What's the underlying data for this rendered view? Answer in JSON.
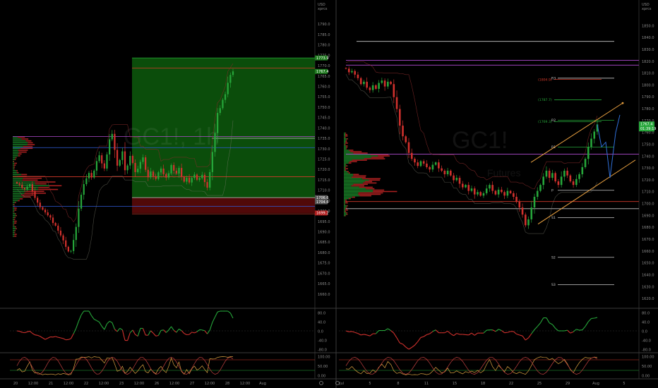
{
  "colors": {
    "background": "#000000",
    "up": "#26a63a",
    "down": "#d0312d",
    "profile_up": "#1c8f2c",
    "profile_down": "#c42626",
    "blue_line": "#2f5bd8",
    "purple_line": "#b04bd0",
    "red_line": "#d43a2a",
    "white_line": "#c8c8c8",
    "orange_channel": "#e8a040",
    "forecast": "#2f6fd8",
    "long_box": "#0d5a0d",
    "stop_box": "#5a0a0a"
  },
  "watermark": {
    "text": "GC1!, 1h",
    "subtext": "Futures"
  },
  "left_panel": {
    "currency": "USD",
    "unit": "xprcs",
    "price_ticks": [
      "1790.0",
      "1785.0",
      "1780.0",
      "1775.0",
      "1770.0",
      "1765.0",
      "1760.0",
      "1755.0",
      "1750.0",
      "1745.0",
      "1740.0",
      "1735.0",
      "1730.0",
      "1725.0",
      "1720.0",
      "1715.0",
      "1710.0",
      "1705.0",
      "1700.0",
      "1695.0",
      "1690.0",
      "1685.0",
      "1680.0",
      "1675.0",
      "1670.0",
      "1665.0",
      "1660.0"
    ],
    "time_ticks": [
      "20",
      "12:00",
      "21",
      "12:00",
      "22",
      "12:00",
      "23",
      "12:00",
      "26",
      "12:00",
      "27",
      "12:00",
      "28",
      "12:00",
      "Aug"
    ],
    "tags": [
      {
        "text": "1773.9",
        "color": "#1f7a1f"
      },
      {
        "text": "1767.4",
        "color": "#1f7a1f"
      },
      {
        "text": "1706.6",
        "color": "#555555"
      },
      {
        "text": "1704.6",
        "color": "#555555"
      },
      {
        "text": "1699.2",
        "color": "#b01c1c"
      }
    ],
    "rsi_ticks": [
      "80.0",
      "40.0",
      "0.0",
      "-40.0",
      "-80.0"
    ],
    "stoch_ticks": [
      "100.00",
      "50.00",
      "0.00"
    ]
  },
  "right_panel": {
    "currency": "USD",
    "unit": "xprcs",
    "price_ticks": [
      "1850.0",
      "1840.0",
      "1830.0",
      "1820.0",
      "1810.0",
      "1800.0",
      "1790.0",
      "1780.0",
      "1770.0",
      "1760.0",
      "1750.0",
      "1740.0",
      "1730.0",
      "1720.0",
      "1710.0",
      "1700.0",
      "1690.0",
      "1680.0",
      "1670.0",
      "1660.0",
      "1650.0",
      "1640.0",
      "1630.0",
      "1620.0"
    ],
    "time_ticks": [
      "Jul",
      "5",
      "8",
      "11",
      "15",
      "18",
      "22",
      "25",
      "29",
      "Aug",
      "5"
    ],
    "pivot_labels": [
      "R3",
      "R2",
      "R1",
      "P",
      "S1",
      "S2",
      "S3"
    ],
    "level_labels": [
      "(1804.9)",
      "(1787.7)",
      "(1769.3)"
    ],
    "tags": [
      {
        "text": "1767.4",
        "color": "#1f7a1f"
      },
      {
        "text": "01:39:19",
        "color": "#1f7a1f"
      }
    ],
    "rsi_ticks": [
      "80.0",
      "40.0",
      "0.0",
      "-40.0",
      "-80.0"
    ],
    "stoch_ticks": [
      "100.00",
      "50.00",
      "0.00"
    ]
  },
  "chart_data": [
    {
      "type": "candlestick",
      "symbol": "GC1!",
      "timeframe": "1h",
      "ylim": [
        1655,
        1795
      ],
      "x_labels": [
        "20",
        "21",
        "22",
        "23",
        "26",
        "27",
        "28",
        "Aug"
      ],
      "close": [
        1713.5,
        1712.8,
        1711.2,
        1710.6,
        1711.9,
        1713.0,
        1709.6,
        1706.5,
        1704.2,
        1702.0,
        1700.8,
        1699.5,
        1698.1,
        1697.0,
        1694.4,
        1693.1,
        1690.7,
        1688.4,
        1686.0,
        1682.9,
        1680.7,
        1680.9,
        1686.2,
        1692.5,
        1701.3,
        1708.0,
        1713.1,
        1715.9,
        1718.5,
        1716.3,
        1719.6,
        1724.2,
        1727.0,
        1723.1,
        1720.6,
        1727.4,
        1734.7,
        1737.3,
        1729.6,
        1722.0,
        1724.7,
        1728.9,
        1719.8,
        1722.1,
        1726.7,
        1723.3,
        1718.9,
        1720.5,
        1723.8,
        1726.0,
        1720.0,
        1716.4,
        1719.1,
        1716.9,
        1715.6,
        1718.8,
        1720.6,
        1717.9,
        1716.3,
        1718.3,
        1722.3,
        1719.6,
        1718.2,
        1720.9,
        1716.6,
        1714.3,
        1716.2,
        1713.9,
        1716.1,
        1717.7,
        1715.2,
        1716.0,
        1717.6,
        1714.1,
        1711.4,
        1718.9,
        1728.6,
        1737.7,
        1747.4,
        1749.7,
        1753.7,
        1756.4,
        1761.9,
        1765.7,
        1767.4
      ],
      "volume_profile_peaks": [
        1732.0,
        1714.0,
        1710.0
      ]
    },
    {
      "type": "candlestick",
      "symbol": "GC1!",
      "timeframe": "4h",
      "ylim": [
        1615,
        1860
      ],
      "x_labels": [
        "Jul",
        "5",
        "8",
        "11",
        "15",
        "18",
        "22",
        "25",
        "29",
        "Aug",
        "5"
      ],
      "close": [
        1814,
        1811,
        1812,
        1809,
        1806,
        1801,
        1803,
        1798,
        1796,
        1800,
        1797,
        1802,
        1804,
        1799,
        1803,
        1801,
        1790,
        1780,
        1766,
        1757,
        1752,
        1743,
        1738,
        1735,
        1732,
        1736,
        1734,
        1731,
        1729,
        1733,
        1735,
        1730,
        1728,
        1725,
        1728,
        1724,
        1720,
        1722,
        1717,
        1714,
        1716,
        1711,
        1713,
        1708,
        1710,
        1707,
        1709,
        1713,
        1716,
        1711,
        1708,
        1712,
        1710,
        1707,
        1711,
        1709,
        1706,
        1702,
        1697,
        1691,
        1682,
        1687,
        1697,
        1706,
        1711,
        1716,
        1723,
        1728,
        1722,
        1726,
        1719,
        1716,
        1723,
        1728,
        1724,
        1719,
        1716,
        1721,
        1725,
        1731,
        1738,
        1748,
        1755,
        1761,
        1767
      ],
      "pivots": {
        "R3": 1806.0,
        "R2": 1770.5,
        "R1": 1748.0,
        "P": 1711.5,
        "S1": 1688.5,
        "S2": 1655.0,
        "S3": 1632.0
      },
      "levels": [
        1804.9,
        1787.7,
        1769.3
      ]
    }
  ]
}
